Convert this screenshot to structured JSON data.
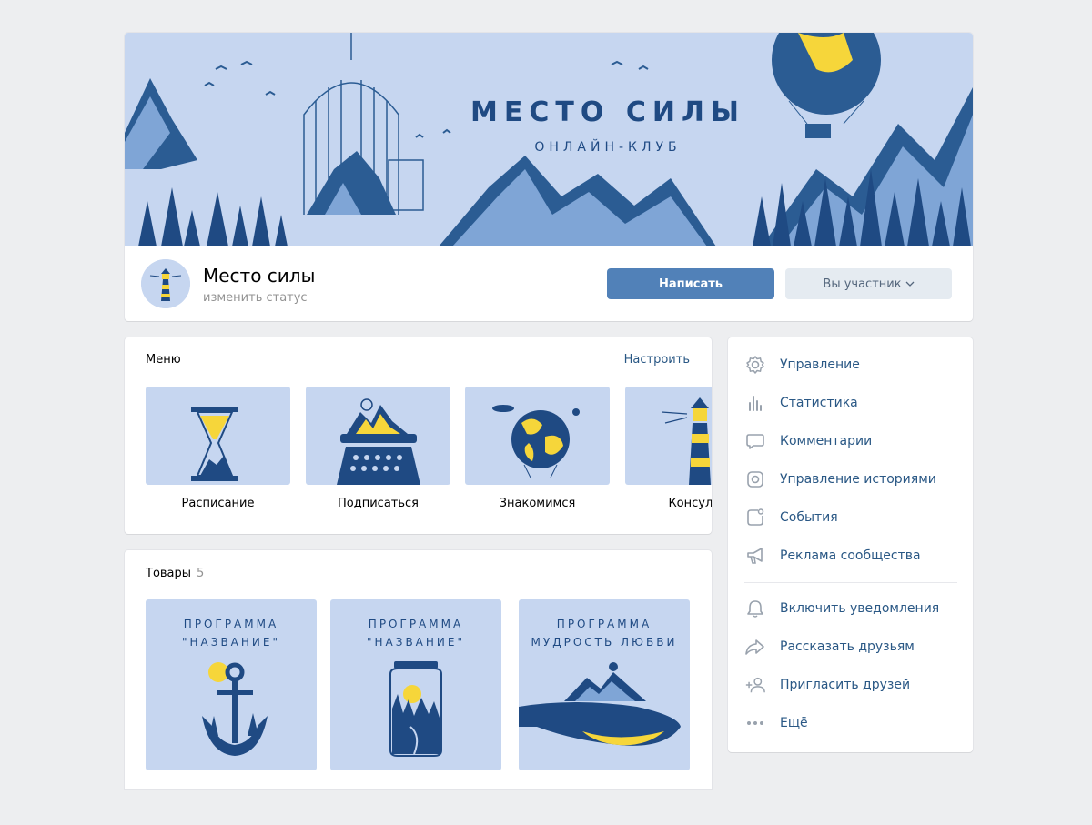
{
  "cover": {
    "title": "МЕСТО СИЛЫ",
    "subtitle": "ОНЛАЙН-КЛУБ"
  },
  "header": {
    "group_name": "Место силы",
    "status_link": "изменить статус",
    "write_button": "Написать",
    "member_button": "Вы участник"
  },
  "menu": {
    "title": "Меню",
    "configure_link": "Настроить",
    "items": [
      {
        "label": "Расписание",
        "icon": "hourglass"
      },
      {
        "label": "Подписаться",
        "icon": "typewriter"
      },
      {
        "label": "Знакомимся",
        "icon": "globe-balloon"
      },
      {
        "label": "Консульт",
        "icon": "lighthouse"
      }
    ]
  },
  "goods": {
    "title": "Товары",
    "count": "5",
    "items": [
      {
        "line1": "ПРОГРАММА",
        "line2": "\"НАЗВАНИЕ\"",
        "icon": "anchor"
      },
      {
        "line1": "ПРОГРАММА",
        "line2": "\"НАЗВАНИЕ\"",
        "icon": "jar"
      },
      {
        "line1": "ПРОГРАММА",
        "line2": "МУДРОСТЬ ЛЮБВИ",
        "icon": "whale"
      }
    ]
  },
  "actions": {
    "items": [
      {
        "label": "Управление",
        "icon": "gear-icon"
      },
      {
        "label": "Статистика",
        "icon": "chart-icon"
      },
      {
        "label": "Комментарии",
        "icon": "comment-icon"
      },
      {
        "label": "Управление историями",
        "icon": "stories-icon"
      },
      {
        "label": "События",
        "icon": "event-icon"
      },
      {
        "label": "Реклама сообщества",
        "icon": "megaphone-icon"
      },
      {
        "label": "Включить уведомления",
        "icon": "bell-icon"
      },
      {
        "label": "Рассказать друзьям",
        "icon": "share-icon"
      },
      {
        "label": "Пригласить друзей",
        "icon": "add-user-icon"
      },
      {
        "label": "Ещё",
        "icon": "more-icon"
      }
    ]
  },
  "colors": {
    "accent": "#5181b8",
    "link": "#2a5885",
    "background": "#edeef0",
    "illustration_blue": "#1f4a83",
    "illustration_light": "#c6d6f0",
    "illustration_yellow": "#f6d63a"
  }
}
